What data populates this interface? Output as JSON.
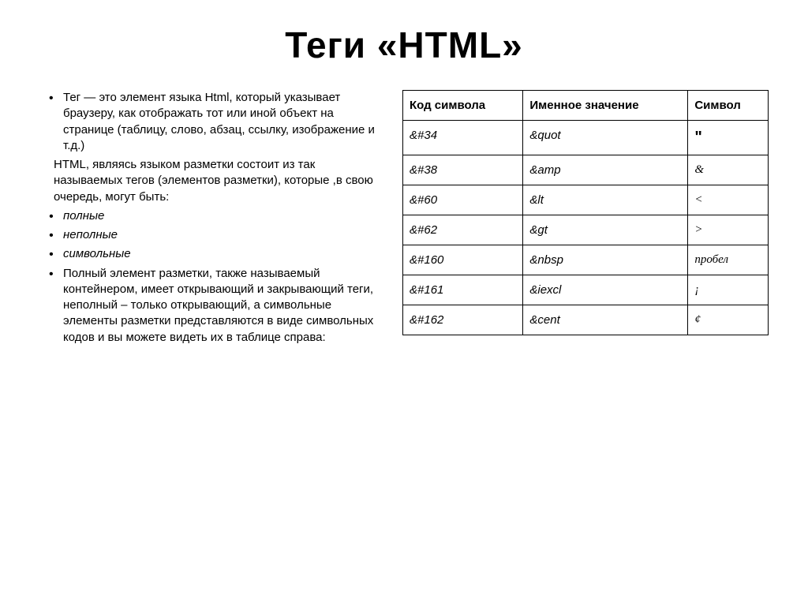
{
  "title": "Теги «HTML»",
  "paragraphs": {
    "p1": "Тег — это элемент языка Html, который указывает браузеру, как отображать тот или иной объект на странице (таблицу, слово, абзац, ссылку, изображение и т.д.)",
    "p2": "HTML, являясь языком разметки состоит из так называемых тегов (элементов разметки), которые ,в свою очередь, могут быть:",
    "b1": "полные",
    "b2": "неполные",
    "b3": "символьные",
    "p3": "Полный элемент разметки, также называемый контейнером, имеет открывающий и закрывающий теги, неполный – только открывающий, а символьные элементы разметки представляются в виде символьных кодов и вы можете видеть их в таблице справа:"
  },
  "table": {
    "headers": {
      "h1": "Код символа",
      "h2": "Именное значение",
      "h3": "Символ"
    },
    "rows": [
      {
        "code": "&#34",
        "name": "&quot",
        "sym": "\""
      },
      {
        "code": "&#38",
        "name": "&amp",
        "sym": "&"
      },
      {
        "code": "&#60",
        "name": "&lt",
        "sym": "<"
      },
      {
        "code": "&#62",
        "name": "&gt",
        "sym": ">"
      },
      {
        "code": "&#160",
        "name": "&nbsp",
        "sym": "пробел"
      },
      {
        "code": "&#161",
        "name": "&iexcl",
        "sym": "¡"
      },
      {
        "code": "&#162",
        "name": "&cent",
        "sym": "¢"
      }
    ]
  }
}
